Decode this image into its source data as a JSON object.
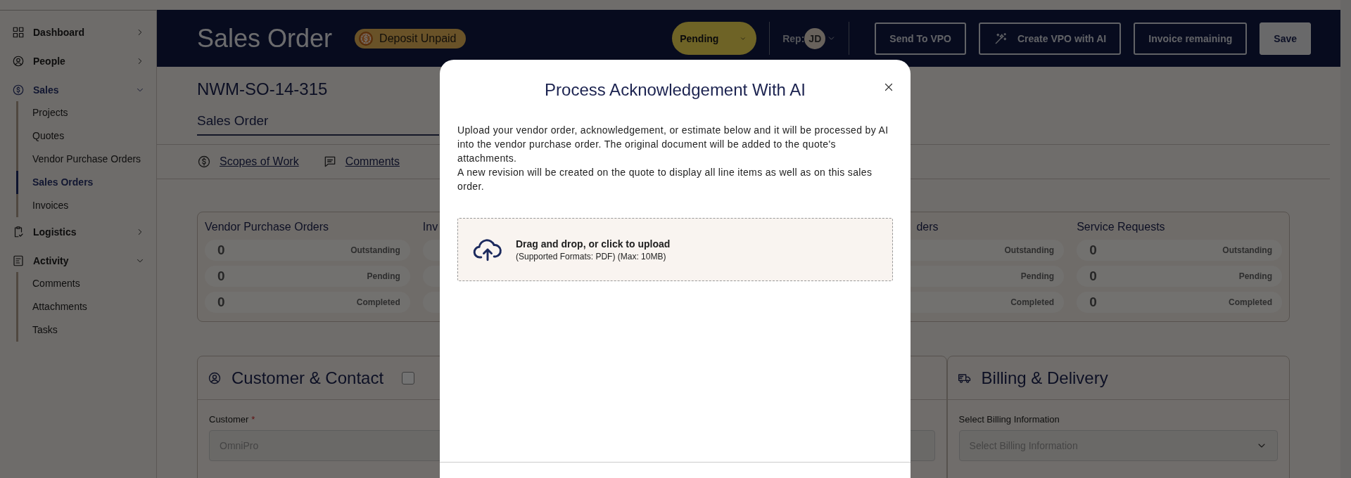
{
  "sidebar": {
    "items": [
      {
        "label": "Dashboard",
        "expanded": false,
        "selected": false
      },
      {
        "label": "People",
        "expanded": false,
        "selected": false
      },
      {
        "label": "Sales",
        "expanded": true,
        "selected": true,
        "children": [
          {
            "label": "Projects",
            "selected": false
          },
          {
            "label": "Quotes",
            "selected": false
          },
          {
            "label": "Vendor Purchase Orders",
            "selected": false
          },
          {
            "label": "Sales Orders",
            "selected": true
          },
          {
            "label": "Invoices",
            "selected": false
          }
        ]
      },
      {
        "label": "Logistics",
        "expanded": false,
        "selected": false
      },
      {
        "label": "Activity",
        "expanded": true,
        "selected": false,
        "children": [
          {
            "label": "Comments",
            "selected": false
          },
          {
            "label": "Attachments",
            "selected": false
          },
          {
            "label": "Tasks",
            "selected": false
          }
        ]
      }
    ]
  },
  "header": {
    "title": "Sales Order",
    "badge": "Deposit Unpaid",
    "status": "Pending",
    "rep_label": "Rep:",
    "rep_initials": "JD",
    "buttons": [
      {
        "label": "Send To VPO",
        "kind": "outline"
      },
      {
        "label": "Create VPO with AI",
        "kind": "ai"
      },
      {
        "label": "Invoice remaining",
        "kind": "outline"
      },
      {
        "label": "Save",
        "kind": "filled"
      }
    ]
  },
  "record": {
    "number": "NWM-SO-14-315",
    "tabs": [
      {
        "label": "Sales Order",
        "selected": true
      }
    ],
    "links": [
      "Scopes of Work",
      "Comments"
    ]
  },
  "summary": {
    "groups": [
      {
        "title": "Vendor Purchase Orders",
        "rows": [
          {
            "count": "0",
            "label": "Outstanding"
          },
          {
            "count": "0",
            "label": "Pending"
          },
          {
            "count": "0",
            "label": "Completed"
          }
        ]
      },
      {
        "title": "Inv"
      },
      {
        "title": "ders",
        "rows": [
          {
            "label": "Outstanding"
          },
          {
            "label": "Pending"
          },
          {
            "label": "Completed"
          }
        ]
      },
      {
        "title": "Service Requests",
        "rows": [
          {
            "count": "0",
            "label": "Outstanding"
          },
          {
            "count": "0",
            "label": "Pending"
          },
          {
            "count": "0",
            "label": "Completed"
          }
        ]
      }
    ]
  },
  "customer_card": {
    "title": "Customer & Contact",
    "checked": false,
    "field": {
      "label": "Customer",
      "required_mark": "*",
      "value": "OmniPro"
    }
  },
  "billing_card": {
    "title": "Billing & Delivery",
    "field": {
      "label": "Select Billing Information",
      "placeholder": "Select Billing Information"
    }
  },
  "modal": {
    "title": "Process Acknowledgement With AI",
    "paragraphs": [
      "Upload your vendor order, acknowledgement, or estimate below and it will be processed by AI into the vendor purchase order. The original document will be added to the quote's attachments.",
      "A new revision will be created on the quote to display all line items as well as on this sales order."
    ],
    "dropzone": {
      "title": "Drag and drop, or click to upload",
      "hint": "(Supported Formats: PDF) (Max: 10MB)"
    }
  }
}
